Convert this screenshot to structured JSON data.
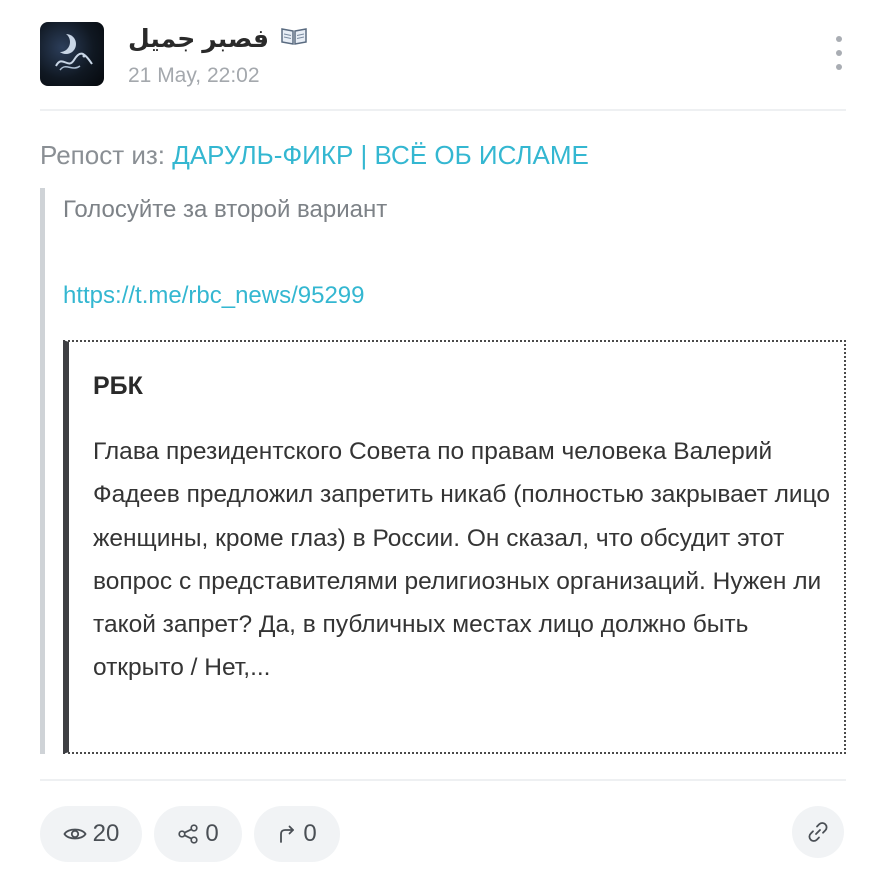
{
  "post": {
    "channel_name": "فصبر جميل",
    "channel_emoji_icon": "open-book-icon",
    "date": "21 May, 22:02"
  },
  "repost": {
    "prefix": "Репост из:",
    "source": "ДАРУЛЬ-ФИКР | ВСЁ ОБ ИСЛАМЕ"
  },
  "quote": {
    "text": "Голосуйте за второй вариант",
    "link": "https://t.me/rbc_news/95299"
  },
  "embed": {
    "title": "РБК",
    "body": "Глава президентского Совета по правам человека Валерий Фадеев предложил запретить никаб (полностью закрывает лицо женщины, кроме глаз) в России. Он сказал, что обсудит этот вопрос с представителями религиозных организаций. Нужен ли такой запрет? Да, в публичных местах лицо должно быть открыто / Нет,..."
  },
  "stats": {
    "views": "20",
    "shares": "0",
    "reposts": "0"
  },
  "colors": {
    "accent": "#34b7d1",
    "muted_text": "#8a8f94",
    "chip_background": "#f1f3f5"
  }
}
